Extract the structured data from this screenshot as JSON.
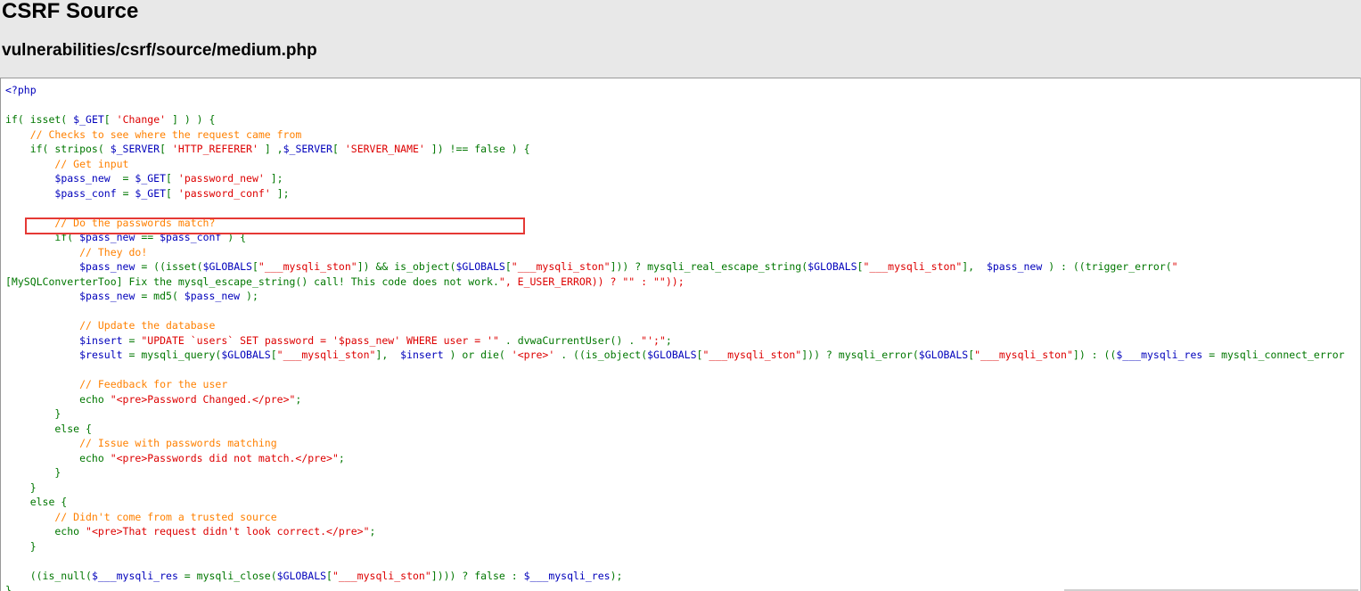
{
  "header": {
    "title": "CSRF Source",
    "subtitle": "vulnerabilities/csrf/source/medium.php"
  },
  "highlight": {
    "color": "#e53935",
    "line_index": 4
  },
  "code_lines": [
    "<?php",
    "",
    "if( isset( $_GET[ 'Change' ] ) ) {",
    "    // Checks to see where the request came from",
    "    if( stripos( $_SERVER[ 'HTTP_REFERER' ] ,$_SERVER[ 'SERVER_NAME' ]) !== false ) {",
    "        // Get input",
    "        $pass_new  = $_GET[ 'password_new' ];",
    "        $pass_conf = $_GET[ 'password_conf' ];",
    "",
    "        // Do the passwords match?",
    "        if( $pass_new == $pass_conf ) {",
    "            // They do!",
    "            $pass_new = ((isset($GLOBALS[\"___mysqli_ston\"]) && is_object($GLOBALS[\"___mysqli_ston\"])) ? mysqli_real_escape_string($GLOBALS[\"___mysqli_ston\"],  $pass_new ) : ((trigger_error(\"",
    "[MySQLConverterToo] Fix the mysql_escape_string() call! This code does not work.\", E_USER_ERROR)) ? \"\" : \"\"));",
    "            $pass_new = md5( $pass_new );",
    "",
    "            // Update the database",
    "            $insert = \"UPDATE `users` SET password = '$pass_new' WHERE user = '\" . dvwaCurrentUser() . \"';\";",
    "            $result = mysqli_query($GLOBALS[\"___mysqli_ston\"],  $insert ) or die( '<pre>' . ((is_object($GLOBALS[\"___mysqli_ston\"])) ? mysqli_error($GLOBALS[\"___mysqli_ston\"]) : (($___mysqli_res = mysqli_connect_error",
    "",
    "            // Feedback for the user",
    "            echo \"<pre>Password Changed.</pre>\";",
    "        }",
    "        else {",
    "            // Issue with passwords matching",
    "            echo \"<pre>Passwords did not match.</pre>\";",
    "        }",
    "    }",
    "    else {",
    "        // Didn't come from a trusted source",
    "        echo \"<pre>That request didn't look correct.</pre>\";",
    "    }",
    "",
    "    ((is_null($___mysqli_res = mysqli_close($GLOBALS[\"___mysqli_ston\"]))) ? false : $___mysqli_res);",
    "}"
  ]
}
